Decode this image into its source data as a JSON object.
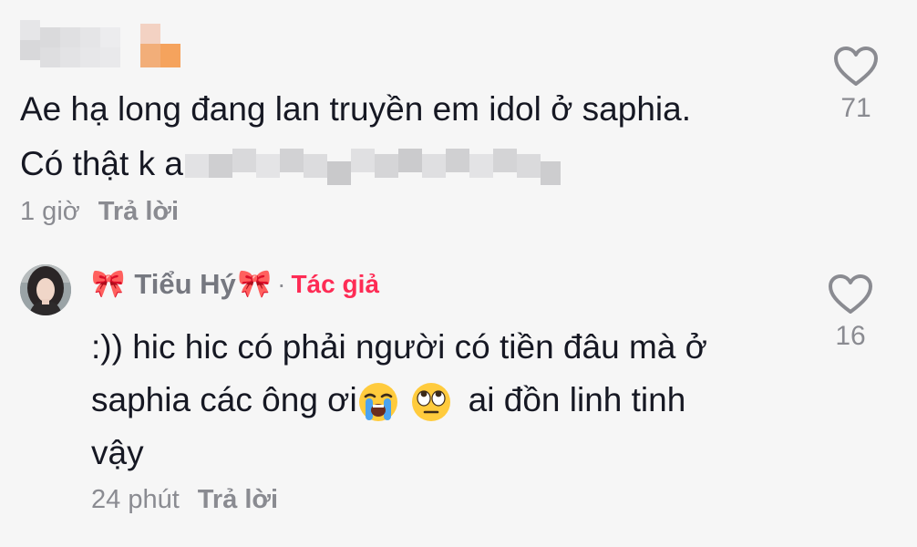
{
  "comments": [
    {
      "text": "Ae hạ long đang lan truyền em idol ở saphia.",
      "text_line2_visible": "Có thật k a",
      "time": "1 giờ",
      "reply_label": "Trả lời",
      "likes": "71",
      "icon": "heart-outline-icon"
    },
    {
      "username": "Tiểu Hý",
      "username_decoration": "🎀",
      "separator": "·",
      "author_badge": "Tác giả",
      "text_line1": ":)) hic hic có phải người có tiền đâu mà ở",
      "text_line2_a": "saphia các ông ơi",
      "text_line2_b": "ai đồn linh tinh",
      "text_line3": "vậy",
      "time": "24 phút",
      "reply_label": "Trả lời",
      "likes": "16",
      "icon": "heart-outline-icon"
    }
  ],
  "colors": {
    "background": "#f6f6f6",
    "text": "#161823",
    "muted": "#8a8b91",
    "author_badge": "#fe2c55"
  }
}
